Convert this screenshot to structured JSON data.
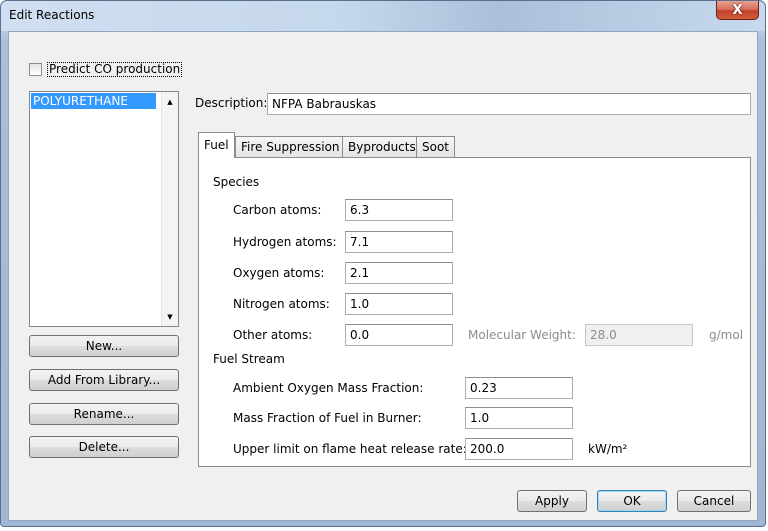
{
  "window": {
    "title": "Edit Reactions",
    "close_glyph": "X"
  },
  "predict_co": {
    "label": "Predict CO production",
    "checked": false
  },
  "reactions_list": {
    "items": [
      "POLYURETHANE"
    ],
    "selected_index": 0
  },
  "left_buttons": {
    "new": "New...",
    "add_from_library": "Add From Library...",
    "rename": "Rename...",
    "delete": "Delete..."
  },
  "description": {
    "label": "Description:",
    "value": "NFPA Babrauskas"
  },
  "tabs": [
    {
      "label": "Fuel",
      "active": true
    },
    {
      "label": "Fire Suppression",
      "active": false
    },
    {
      "label": "Byproducts",
      "active": false
    },
    {
      "label": "Soot",
      "active": false
    }
  ],
  "species": {
    "title": "Species",
    "carbon": {
      "label": "Carbon atoms:",
      "value": "6.3"
    },
    "hydrogen": {
      "label": "Hydrogen atoms:",
      "value": "7.1"
    },
    "oxygen": {
      "label": "Oxygen atoms:",
      "value": "2.1"
    },
    "nitrogen": {
      "label": "Nitrogen atoms:",
      "value": "1.0"
    },
    "other": {
      "label": "Other atoms:",
      "value": "0.0"
    },
    "molecular_weight": {
      "label": "Molecular Weight:",
      "value": "28.0",
      "unit": "g/mol"
    }
  },
  "fuel_stream": {
    "title": "Fuel Stream",
    "ambient_oxygen": {
      "label": "Ambient Oxygen Mass Fraction:",
      "value": "0.23"
    },
    "fuel_in_burner": {
      "label": "Mass Fraction of Fuel in Burner:",
      "value": "1.0"
    },
    "hrr_limit": {
      "label": "Upper limit on flame heat release rate:",
      "value": "200.0",
      "unit": "kW/m²"
    }
  },
  "dialog_buttons": {
    "apply": "Apply",
    "ok": "OK",
    "cancel": "Cancel"
  },
  "colors": {
    "selection": "#3399ff",
    "close_button": "#c0412a",
    "title_bar": "#c5d7ec"
  }
}
